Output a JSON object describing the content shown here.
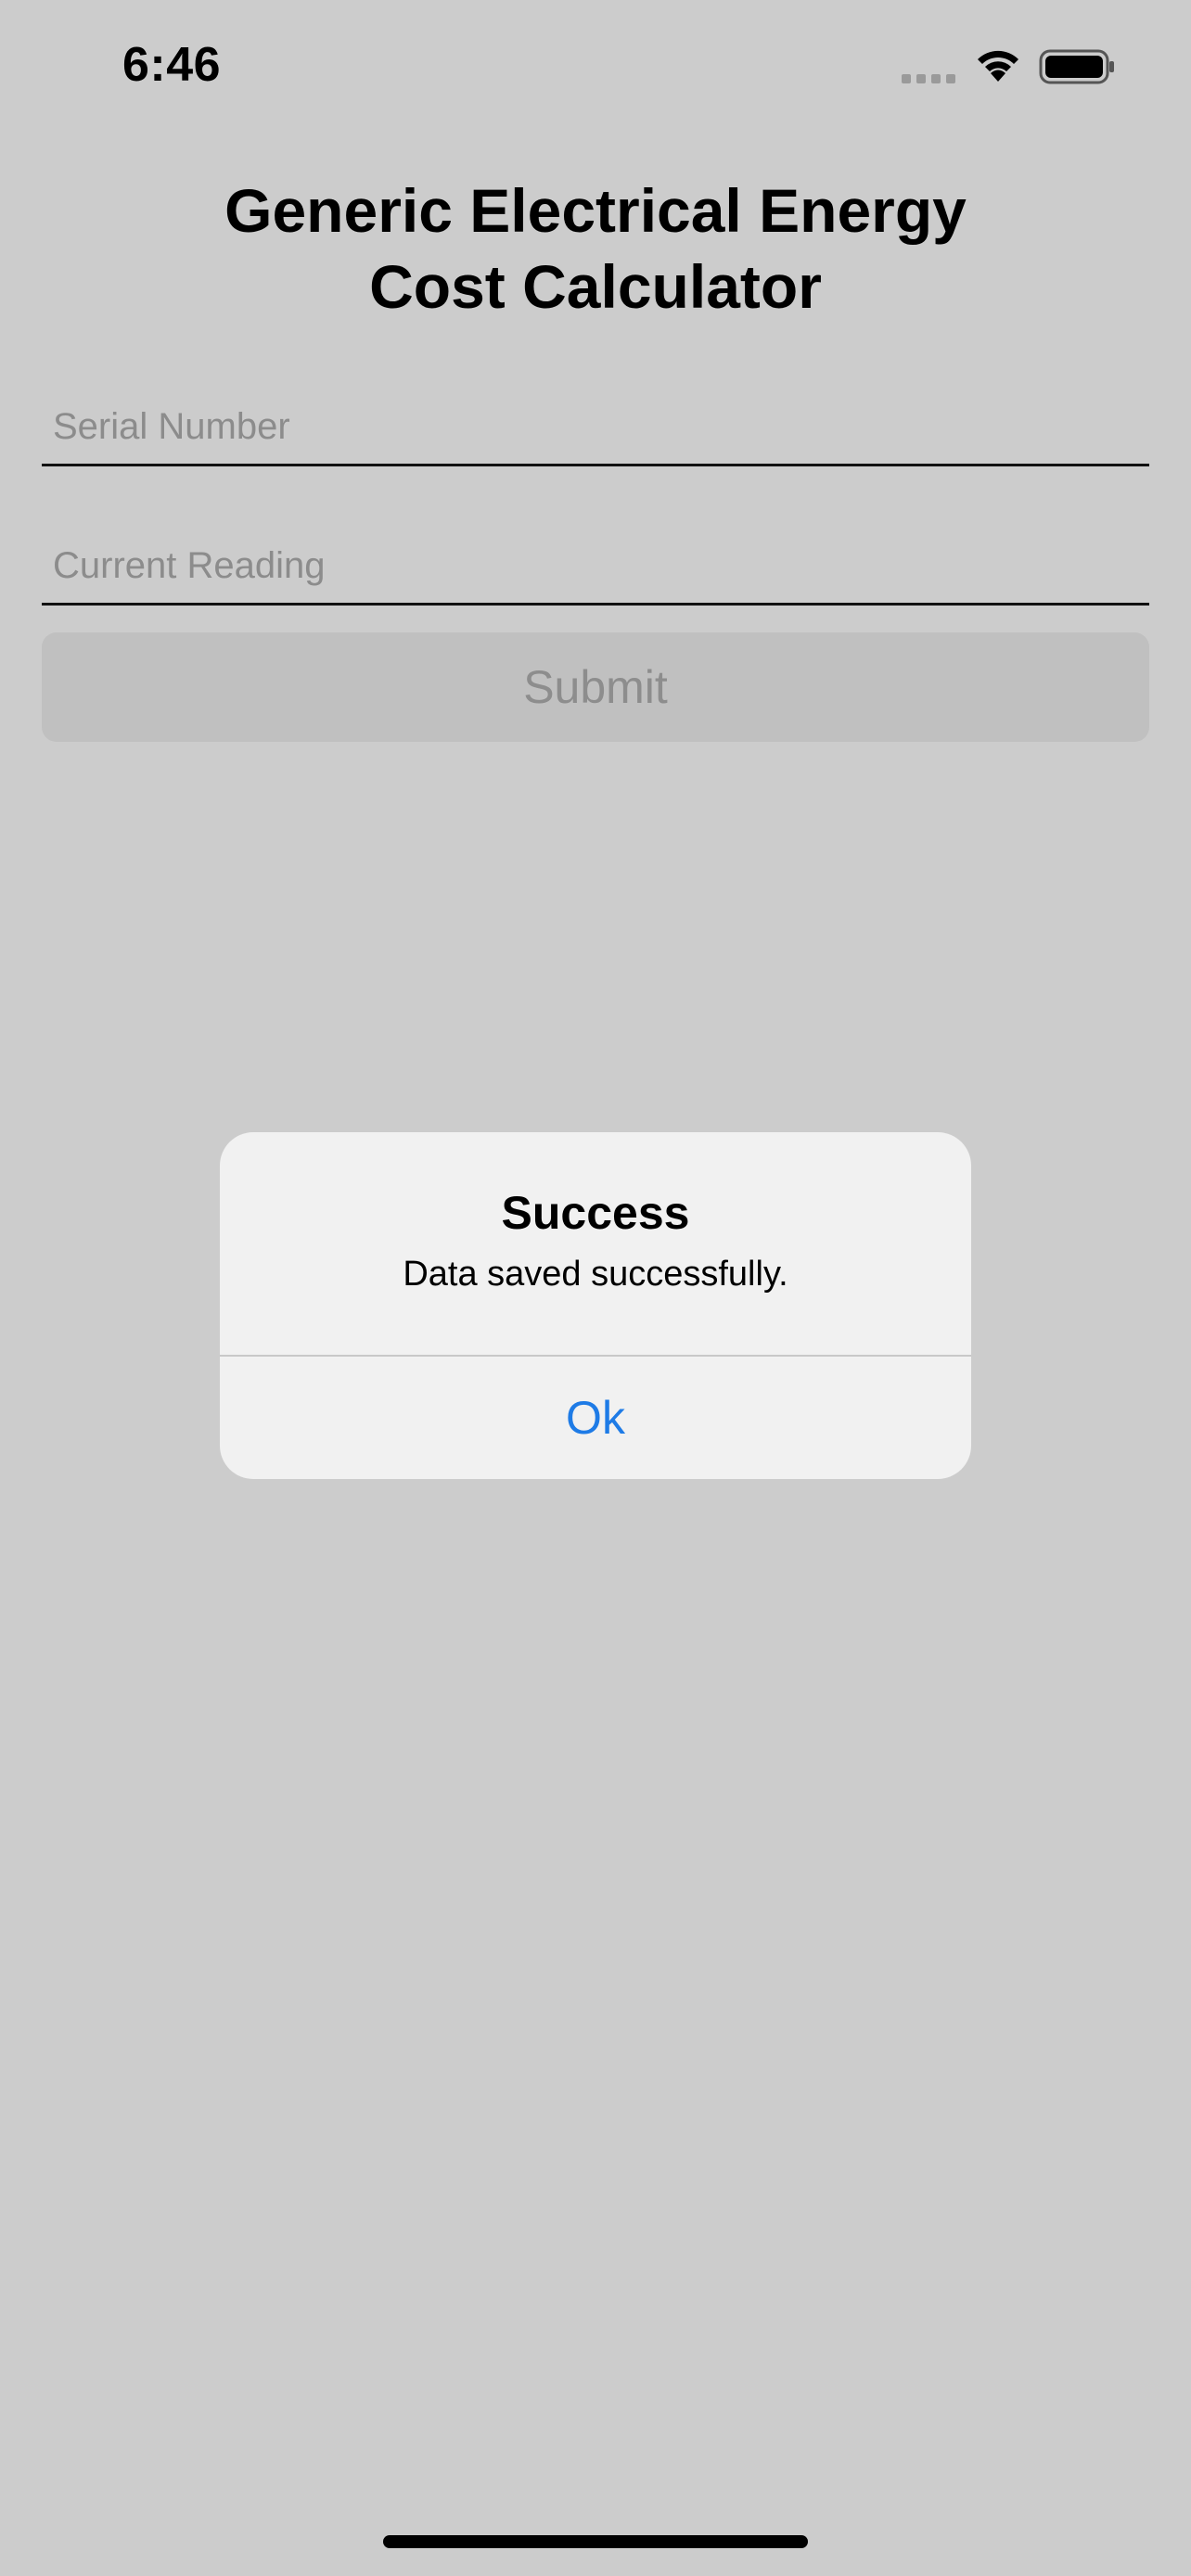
{
  "status_bar": {
    "time": "6:46"
  },
  "page": {
    "title_line1": "Generic Electrical Energy",
    "title_line2": "Cost Calculator"
  },
  "form": {
    "serial_number": {
      "value": "",
      "placeholder": "Serial Number"
    },
    "current_reading": {
      "value": "",
      "placeholder": "Current Reading"
    },
    "submit_label": "Submit"
  },
  "alert": {
    "title": "Success",
    "message": "Data saved successfully.",
    "ok_label": "Ok"
  },
  "colors": {
    "background": "#cccccc",
    "alert_background": "#f1f1f1",
    "accent_blue": "#1e7be6",
    "button_disabled": "#c0c0c0"
  },
  "icons": [
    "cellular-icon",
    "wifi-icon",
    "battery-icon"
  ]
}
